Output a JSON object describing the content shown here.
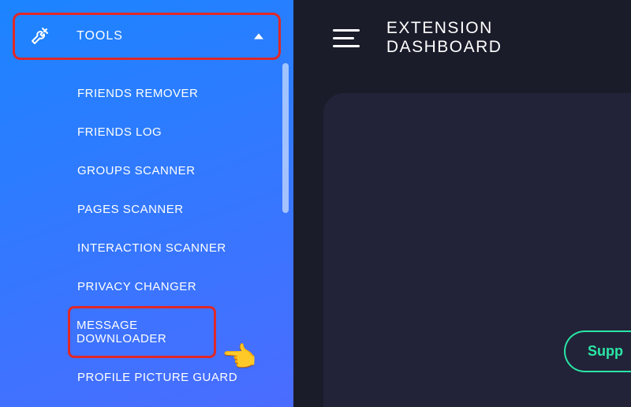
{
  "sidebar": {
    "header_label": "TOOLS",
    "items": [
      {
        "label": "FRIENDS REMOVER"
      },
      {
        "label": "FRIENDS LOG"
      },
      {
        "label": "GROUPS SCANNER"
      },
      {
        "label": "PAGES SCANNER"
      },
      {
        "label": "INTERACTION SCANNER"
      },
      {
        "label": "PRIVACY CHANGER"
      },
      {
        "label": "MESSAGE DOWNLOADER"
      },
      {
        "label": "PROFILE PICTURE GUARD"
      }
    ]
  },
  "header": {
    "title": "EXTENSION DASHBOARD"
  },
  "buttons": {
    "support": "Supp"
  },
  "annotations": {
    "pointer_emoji": "👉"
  }
}
